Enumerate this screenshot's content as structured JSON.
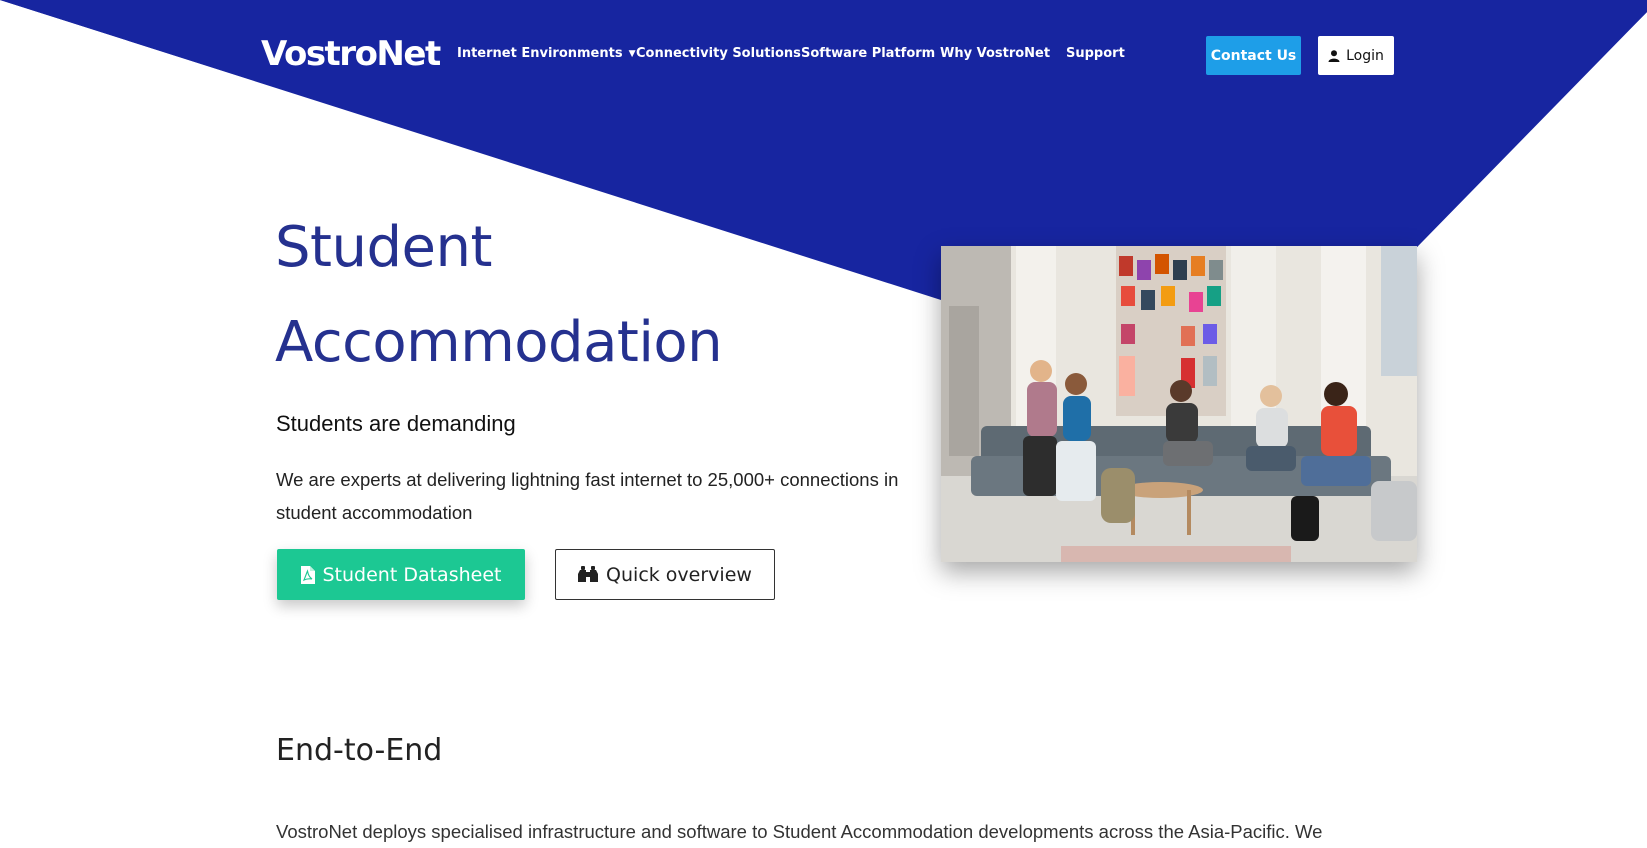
{
  "header": {
    "logo_text": "VostroNet",
    "nav": [
      {
        "label": "Internet Environments",
        "has_dropdown": true
      },
      {
        "label": "Connectivity Solutions"
      },
      {
        "label": "Software Platform"
      },
      {
        "label": "Why VostroNet"
      },
      {
        "label": "Support"
      }
    ],
    "contact_label": "Contact Us",
    "login_label": "Login"
  },
  "hero": {
    "title_line1": "Student",
    "title_line2": "Accommodation",
    "subtitle": "Students are demanding",
    "text": "We are experts at delivering lightning fast internet to 25,000+ connections in student accommodation",
    "datasheet_label": "Student Datasheet",
    "overview_label": "Quick overview"
  },
  "section": {
    "heading": "End-to-End",
    "text": "VostroNet deploys specialised infrastructure and software to Student Accommodation developments across the Asia-Pacific. We"
  },
  "colors": {
    "brand_blue": "#1725a0",
    "title_blue": "#25318f",
    "contact_button": "#1e9ee8",
    "datasheet_button": "#1cc893"
  },
  "icons": {
    "dropdown": "chevron-down-icon",
    "login": "user-icon",
    "datasheet": "file-pdf-icon",
    "overview": "binoculars-icon"
  }
}
